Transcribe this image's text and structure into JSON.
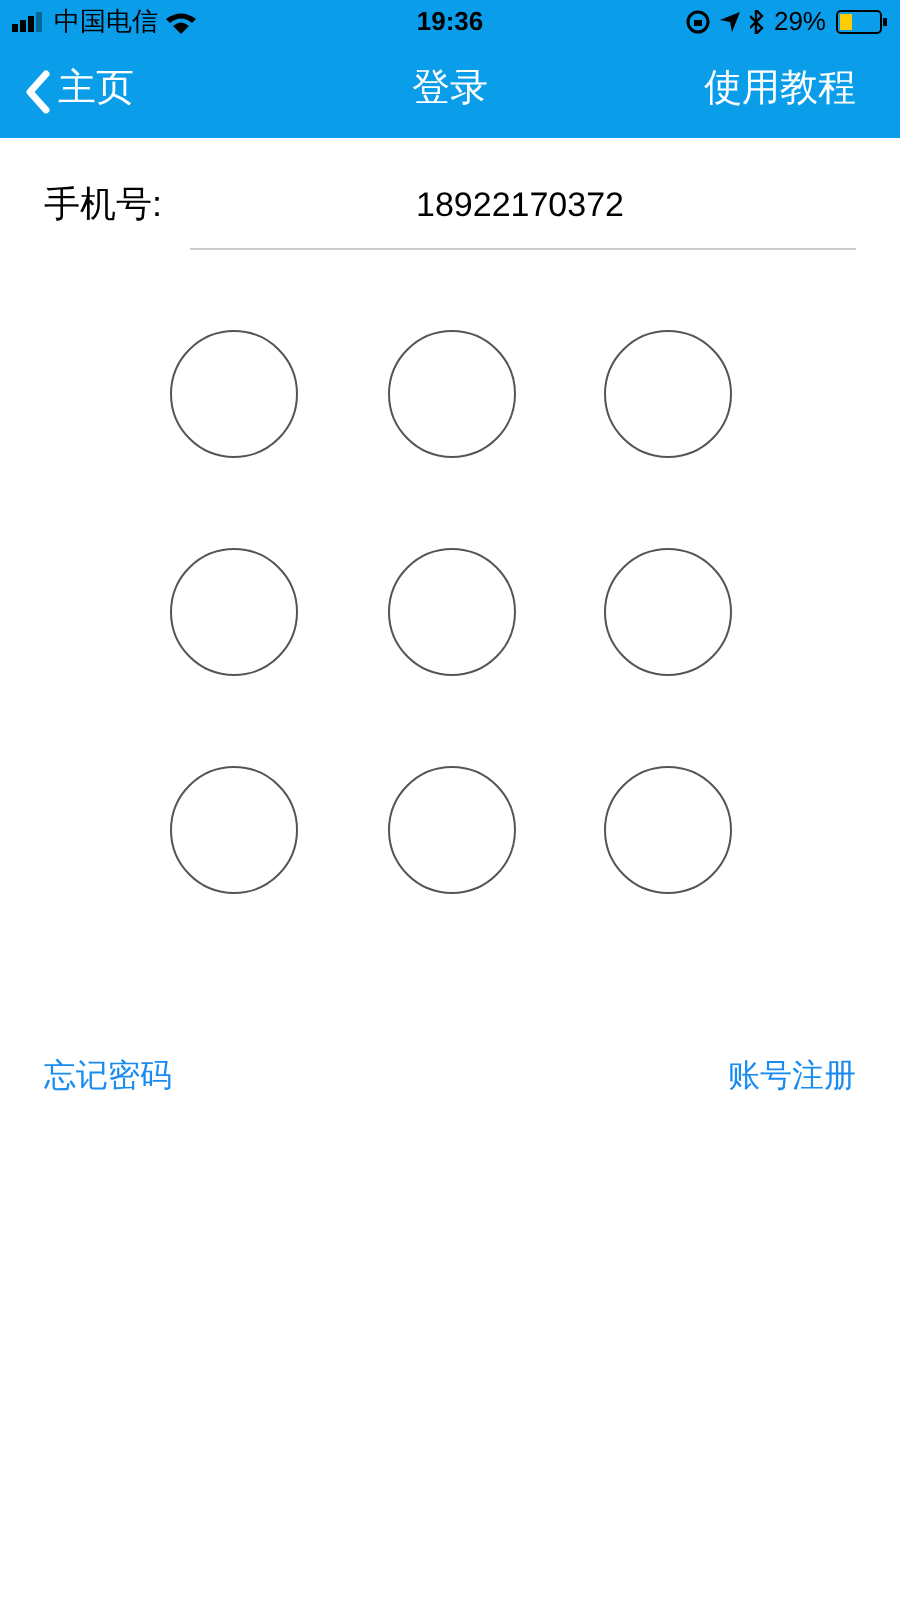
{
  "status_bar": {
    "carrier": "中国电信",
    "time": "19:36",
    "battery": "29%"
  },
  "nav_bar": {
    "back": "主页",
    "title": "登录",
    "action": "使用教程"
  },
  "phone": {
    "label": "手机号:",
    "value": "18922170372"
  },
  "pattern_dots": [
    {
      "selected": false
    },
    {
      "selected": false
    },
    {
      "selected": false
    },
    {
      "selected": false
    },
    {
      "selected": false
    },
    {
      "selected": false
    },
    {
      "selected": false
    },
    {
      "selected": false
    },
    {
      "selected": false
    }
  ],
  "links": [
    "忘记密码",
    "账号注册"
  ]
}
